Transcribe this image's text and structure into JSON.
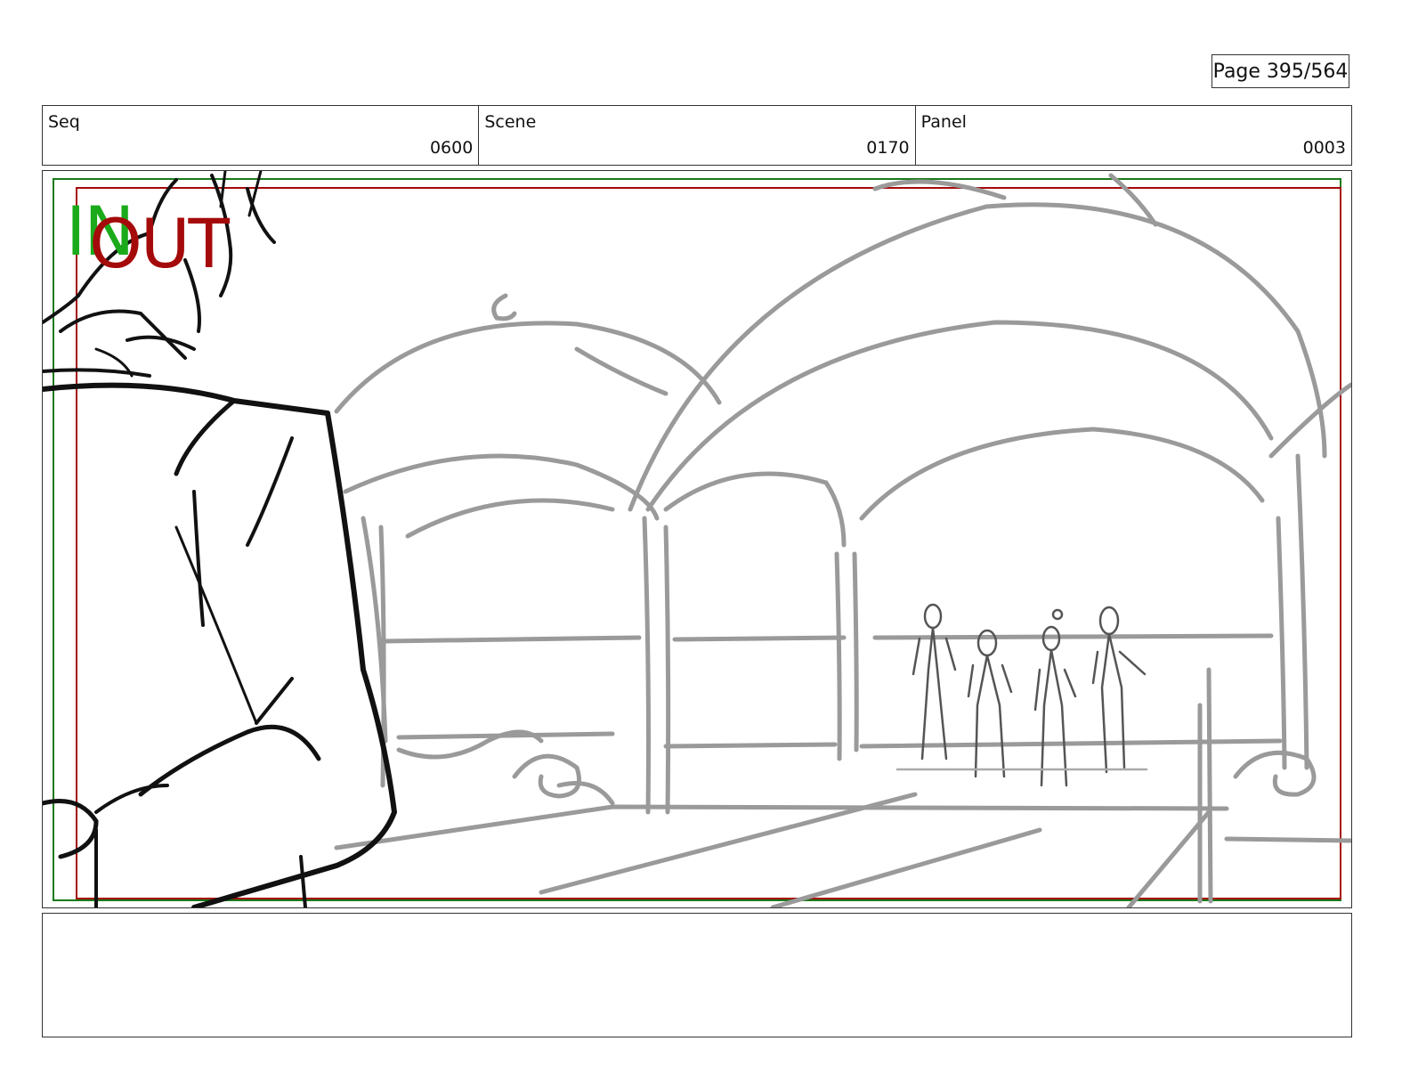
{
  "page": {
    "label": "Page 395/564"
  },
  "header": {
    "fields": [
      {
        "label": "Seq",
        "value": "0600"
      },
      {
        "label": "Scene",
        "value": "0170"
      },
      {
        "label": "Panel",
        "value": "0003"
      }
    ]
  },
  "frame": {
    "in_label": "IN",
    "out_label": "OUT",
    "colors": {
      "in": "#1aaa1a",
      "out": "#a50a0a",
      "sketch_bg": "#9a9a9a",
      "sketch_fg": "#111111"
    }
  },
  "notes": {
    "text": ""
  }
}
